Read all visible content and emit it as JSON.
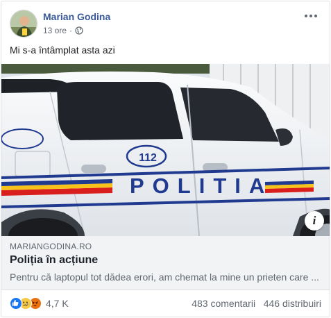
{
  "post": {
    "author": "Marian Godina",
    "time": "13 ore",
    "privacy_icon": "globe-icon",
    "text": "Mi s-a întâmplat asta azi"
  },
  "photo": {
    "car_lettering": "POLITIA",
    "emergency_number": "112",
    "info_icon": "i"
  },
  "link": {
    "domain": "MARIANGODINA.RO",
    "title": "Poliția în acțiune",
    "description": "Pentru că laptopul tot dădea erori, am chemat la mine un prieten care ..."
  },
  "footer": {
    "reactions": [
      "like-icon",
      "sad-icon",
      "angry-icon"
    ],
    "reaction_count": "4,7 K",
    "comments": "483 comentarii",
    "shares": "446 distribuiri"
  },
  "colors": {
    "author_link": "#385898",
    "car_blue": "#1f3a8f",
    "flag_red": "#d91e1e",
    "flag_yellow": "#f7c31b"
  }
}
